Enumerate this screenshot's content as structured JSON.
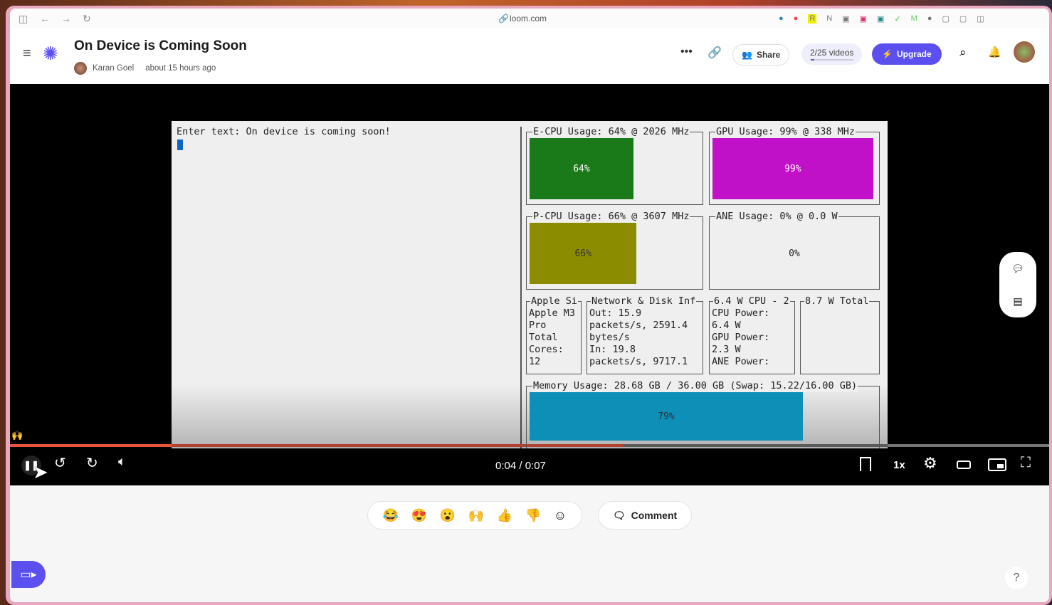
{
  "browser": {
    "url": "loom.com"
  },
  "header": {
    "title": "On Device is Coming Soon",
    "author": "Karan Goel",
    "time": "about 15 hours ago",
    "share": "Share",
    "videos": "2/25 videos",
    "upgrade": "Upgrade",
    "accent": "#5b4ff0"
  },
  "terminal": {
    "prompt": "Enter text: On device is coming soon!",
    "ecpu": {
      "label": "E-CPU Usage: 64% @ 2026 MHz",
      "value": "64%",
      "percent": 64,
      "color": "#1a7a1a"
    },
    "gpu": {
      "label": "GPU Usage: 99% @ 338 MHz",
      "value": "99%",
      "percent": 99,
      "color": "#c010c8"
    },
    "pcpu": {
      "label": "P-CPU Usage: 66% @ 3607 MHz",
      "value": "66%",
      "percent": 66,
      "color": "#8c8c00"
    },
    "ane": {
      "label": "ANE Usage: 0% @ 0.0 W",
      "value": "0%",
      "percent": 0
    },
    "apple": {
      "label": "Apple Si",
      "text": "Apple M3\nPro\nTotal\nCores:\n12"
    },
    "network": {
      "label": "Network & Disk Inf",
      "text": "Out: 15.9\npackets/s, 2591.4\nbytes/s\nIn: 19.8\npackets/s, 9717.1"
    },
    "power": {
      "label": "6.4 W CPU - 2",
      "text": "CPU Power:\n6.4 W\nGPU Power:\n2.3 W\nANE Power:"
    },
    "total": {
      "label": "8.7 W Total"
    },
    "memory": {
      "label": "Memory Usage: 28.68 GB / 36.00 GB (Swap: 15.22/16.00 GB)",
      "value": "79%",
      "percent": 79,
      "color": "#0e8fb8"
    }
  },
  "player": {
    "time": "0:04 / 0:07",
    "progress": 0.59,
    "speed": "1x",
    "reaction_overlay": "🙌"
  },
  "reactions": [
    "😂",
    "😍",
    "😮",
    "🙌",
    "👍",
    "👎"
  ],
  "comment": "Comment",
  "help": "?"
}
